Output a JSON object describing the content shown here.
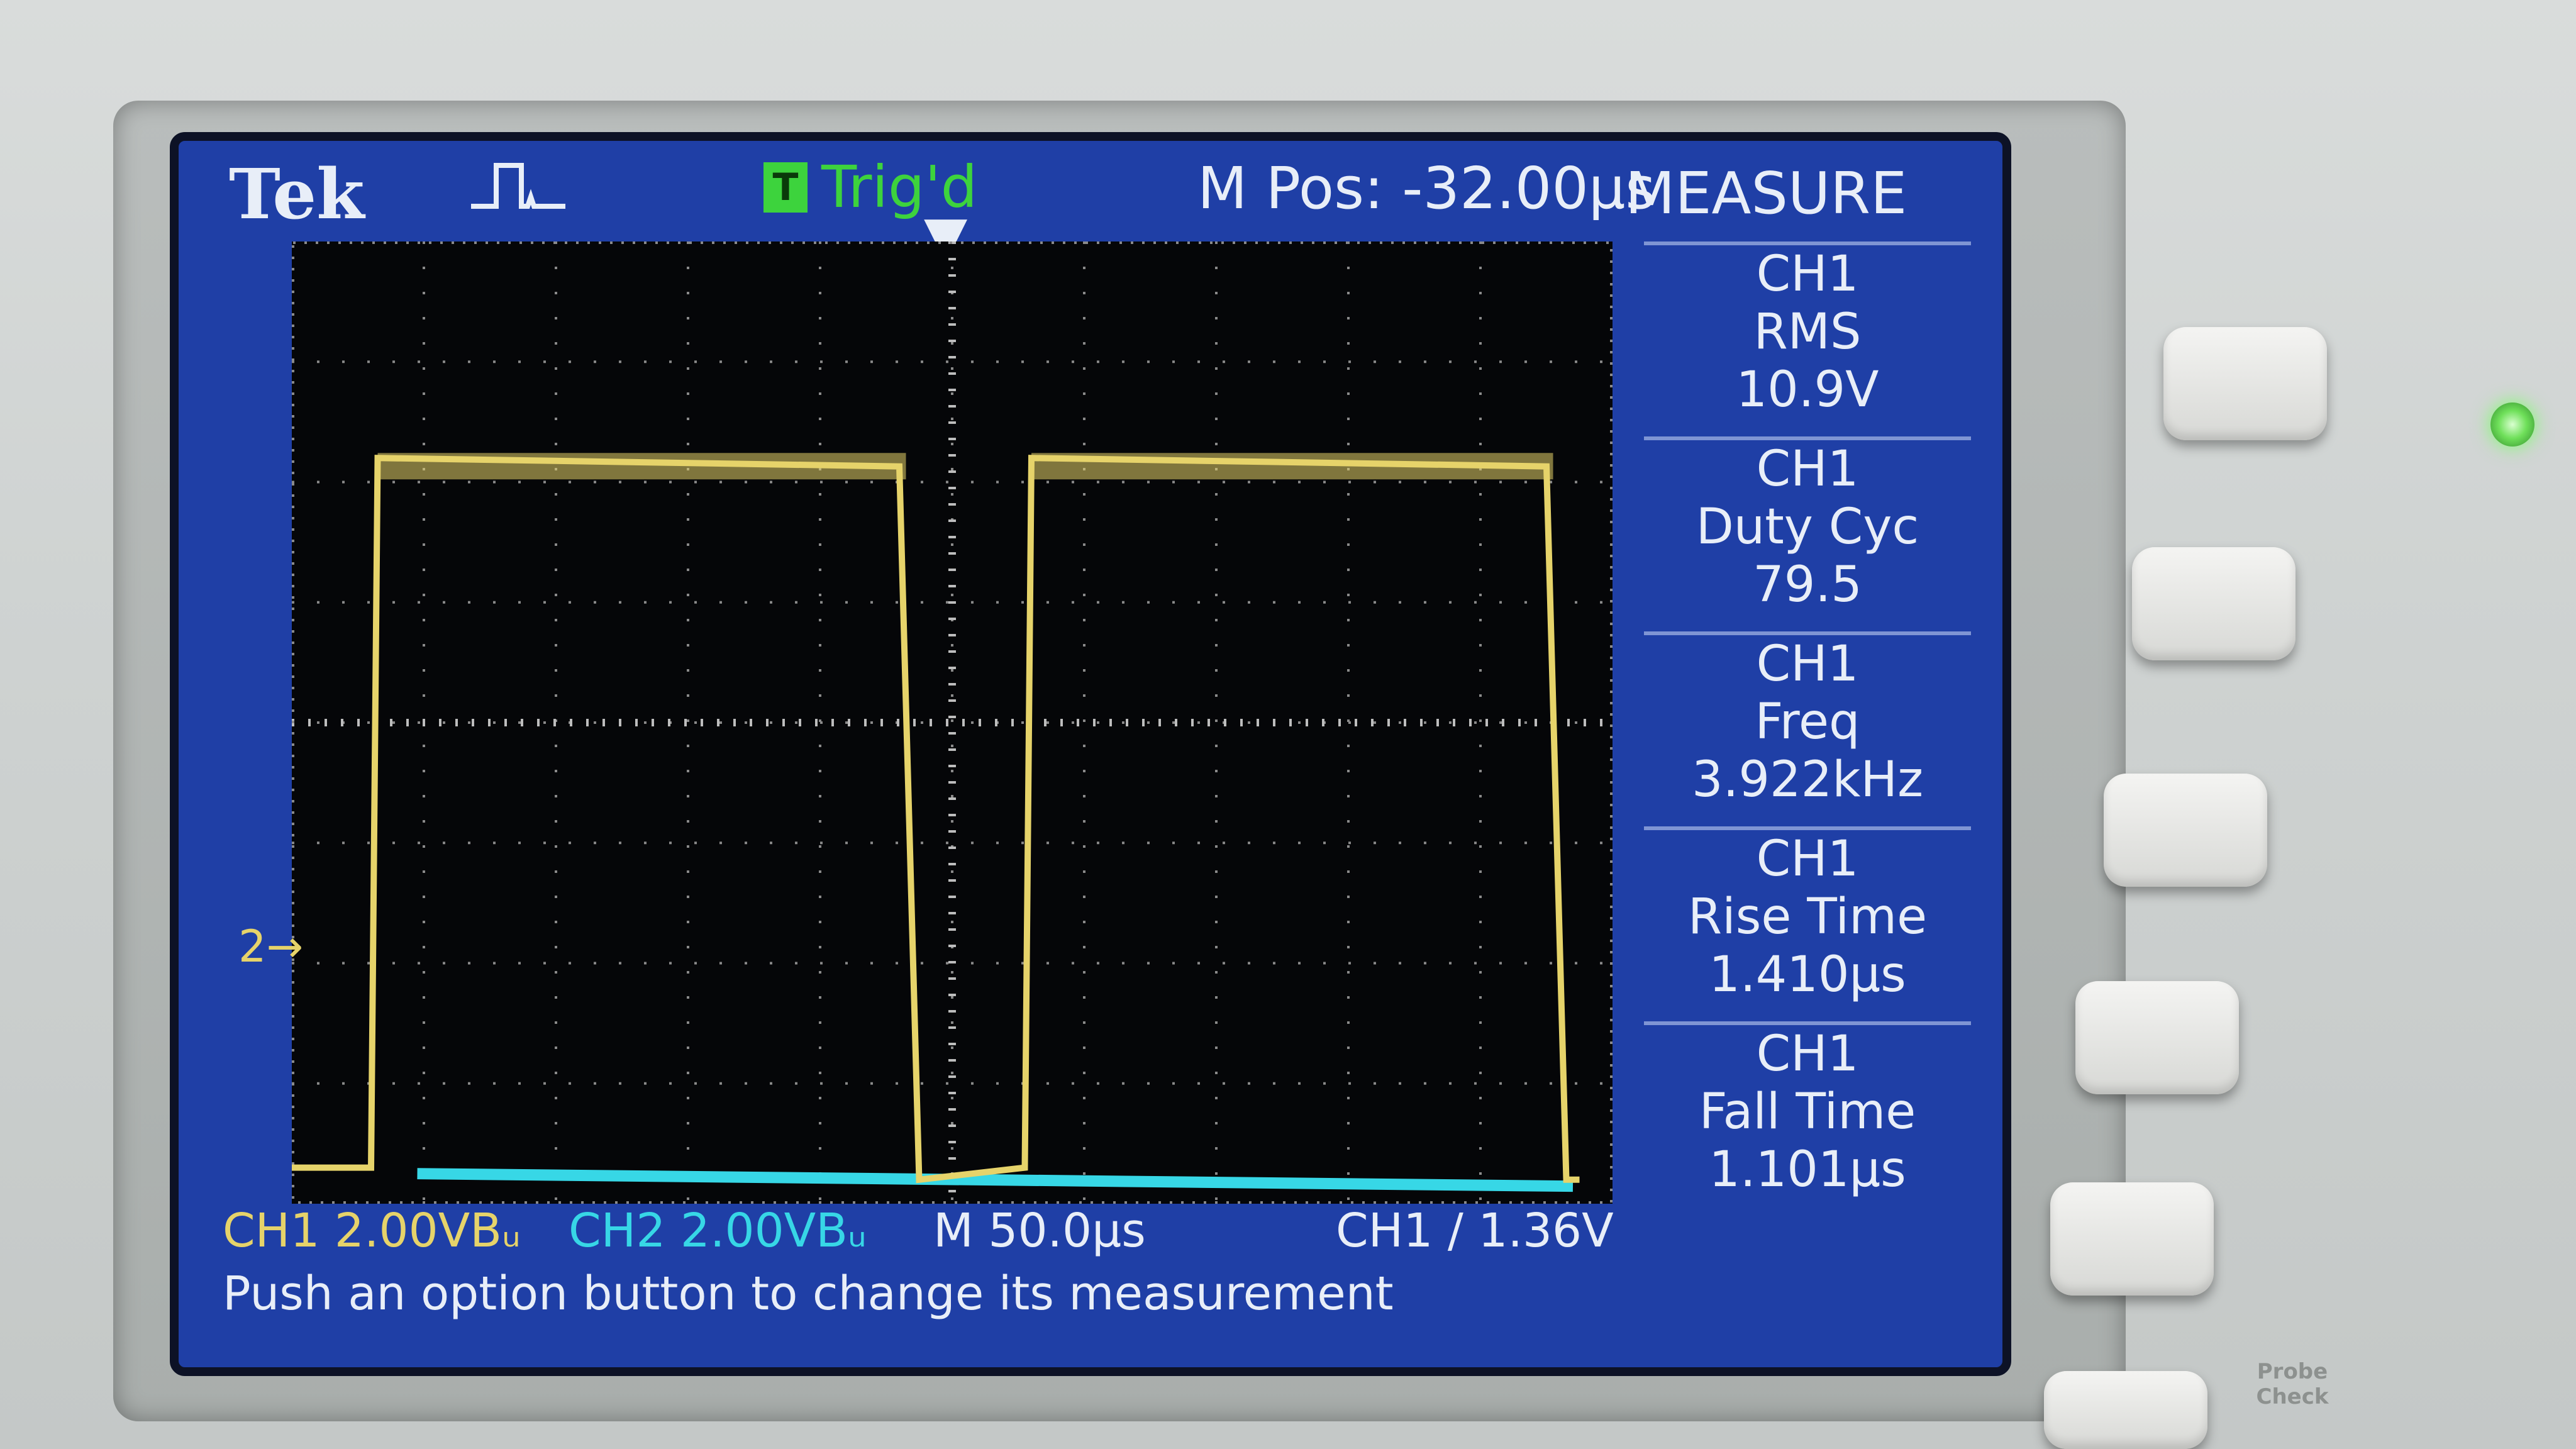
{
  "header": {
    "brand": "Tek",
    "acquisition_icon": "pulse-icon",
    "trigger_status": "Trig'd",
    "trigger_badge": "T",
    "horizontal_position": "M Pos: -32.00µs",
    "menu_title": "MEASURE"
  },
  "measurements": [
    {
      "source": "CH1",
      "name": "RMS",
      "value": "10.9V"
    },
    {
      "source": "CH1",
      "name": "Duty Cyc",
      "value": "79.5"
    },
    {
      "source": "CH1",
      "name": "Freq",
      "value": "3.922kHz"
    },
    {
      "source": "CH1",
      "name": "Rise Time",
      "value": "1.410µs"
    },
    {
      "source": "CH1",
      "name": "Fall Time",
      "value": "1.101µs"
    }
  ],
  "status": {
    "ch1_scale": "CH1  2.00VBᵤ",
    "ch2_scale": "CH2  2.00VBᵤ",
    "timebase": "M 50.0µs",
    "trigger": "CH1 ∕ 1.36V",
    "help_text": "Push an option button to change its measurement"
  },
  "ground_marker": "2→",
  "colors": {
    "screen_bg": "#1f3fa6",
    "ch1": "#e6d36a",
    "ch2": "#37d7e6",
    "trigger_green": "#3dd33d"
  },
  "waveforms": {
    "ch1_high_divisions": [
      {
        "start": 0.6,
        "end": 4.6
      },
      {
        "start": 5.55,
        "end": 9.5
      }
    ],
    "ch1_high_level_div": 6.2,
    "ch1_low_level_div": 0.3,
    "ch2_level_div": 0.25
  }
}
